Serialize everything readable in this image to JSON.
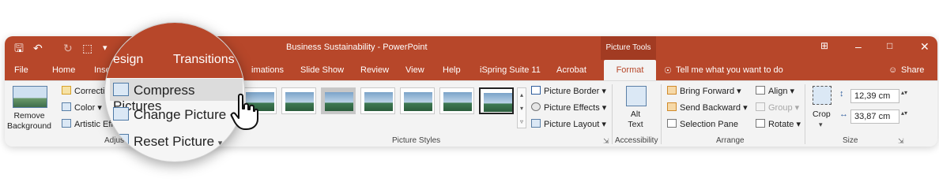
{
  "window": {
    "title": "Business Sustainability - PowerPoint",
    "context_label": "Picture Tools",
    "accent_color": "#b7472a"
  },
  "tabs": {
    "file": "File",
    "home": "Home",
    "insert_partial": "Inse",
    "animations_partial": "imations",
    "slide_show": "Slide Show",
    "review": "Review",
    "view": "View",
    "help": "Help",
    "ispring": "iSpring Suite 11",
    "acrobat": "Acrobat",
    "format": "Format",
    "tell_me": "Tell me what you want to do",
    "share": "Share"
  },
  "ribbon": {
    "remove_background": "Remove\nBackground",
    "corrections_partial": "Correcti",
    "color_partial": "Color",
    "artistic_partial": "Artistic Effe",
    "adjust_partial": "Adjus",
    "picture_styles_label": "Picture Styles",
    "picture_border": "Picture Border",
    "picture_effects": "Picture Effects",
    "picture_layout": "Picture Layout",
    "alt_text": "Alt\nText",
    "accessibility_label": "Accessibility",
    "bring_forward": "Bring Forward",
    "send_backward": "Send Backward",
    "selection_pane": "Selection Pane",
    "align": "Align",
    "group": "Group",
    "rotate": "Rotate",
    "arrange_label": "Arrange",
    "crop": "Crop",
    "height_value": "12,39 cm",
    "width_value": "33,87 cm",
    "size_label": "Size"
  },
  "magnifier": {
    "tab_design_partial": "esign",
    "tab_transitions": "Transitions",
    "compress_pictures": "Compress Pictures",
    "change_picture": "Change Picture",
    "reset_picture": "Reset Picture"
  }
}
